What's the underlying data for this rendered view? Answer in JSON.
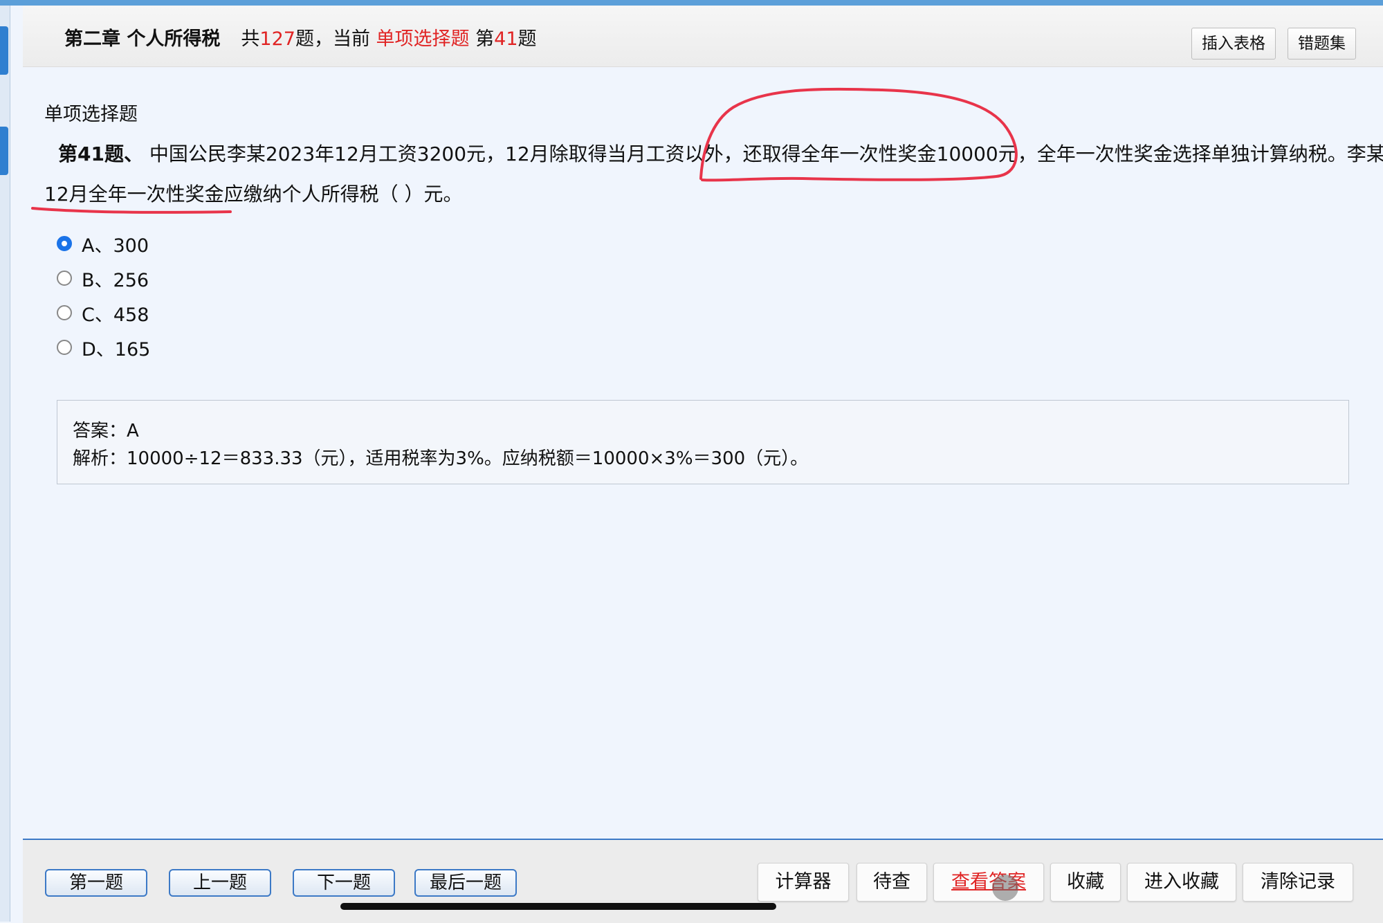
{
  "header": {
    "chapter": "第二章 个人所得税",
    "total_prefix": "共",
    "total_count": "127",
    "total_suffix": "题，当前",
    "question_type": "单项选择题",
    "current_prefix": "第",
    "current_number": "41",
    "current_suffix": "题",
    "insert_table_label": "插入表格",
    "wrong_set_label": "错题集"
  },
  "question": {
    "type_label": "单项选择题",
    "number_label": "第41题、",
    "text_line1": "中国公民李某2023年12月工资3200元，12月除取得当月工资以外，还取得全年一次性奖金10000元，全年一次性奖金选择单独计算纳税。李某",
    "text_line2": "12月全年一次性奖金应缴纳个人所得税（    ）元。",
    "options": [
      {
        "label": "A、300",
        "selected": true
      },
      {
        "label": "B、256",
        "selected": false
      },
      {
        "label": "C、458",
        "selected": false
      },
      {
        "label": "D、165",
        "selected": false
      }
    ]
  },
  "answer": {
    "answer_line": "答案：A",
    "analysis_line": "解析：10000÷12＝833.33（元），适用税率为3%。应纳税额＝10000×3%＝300（元）。"
  },
  "footer": {
    "first_label": "第一题",
    "prev_label": "上一题",
    "next_label": "下一题",
    "last_label": "最后一题",
    "calculator_label": "计算器",
    "pending_label": "待查",
    "view_answer_label": "查看答案",
    "favorite_label": "收藏",
    "enter_favorites_label": "进入收藏",
    "clear_records_label": "清除记录"
  },
  "colors": {
    "accent_red": "#e02424",
    "accent_blue": "#1a73e8",
    "annotation_red": "#e8344a"
  }
}
